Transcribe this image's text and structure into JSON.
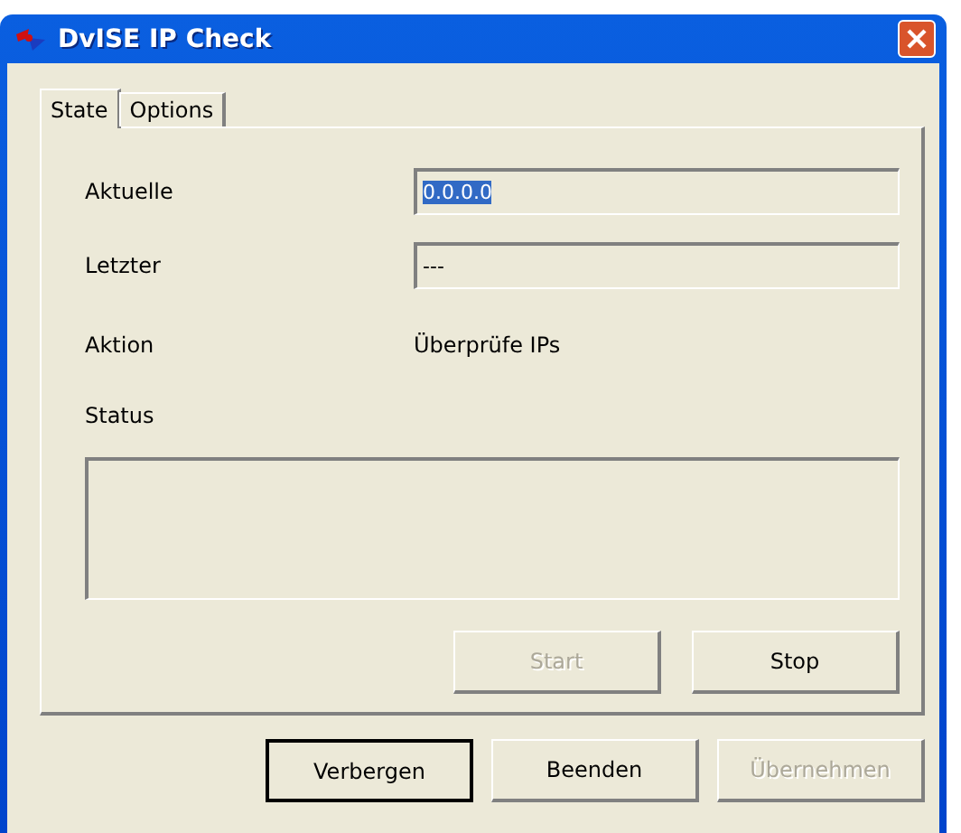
{
  "window": {
    "title": "DvISE IP Check"
  },
  "tabs": [
    {
      "label": "State",
      "selected": true
    },
    {
      "label": "Options",
      "selected": false
    }
  ],
  "fields": [
    {
      "label": "Aktuelle",
      "value": "0.0.0.0",
      "selected": true
    },
    {
      "label": "Letzter",
      "value": "---",
      "selected": false
    }
  ],
  "action": {
    "label": "Aktion",
    "value": "Überprüfe IPs"
  },
  "status": {
    "label": "Status"
  },
  "panel_buttons": [
    {
      "label": "Start",
      "disabled": true,
      "default": false
    },
    {
      "label": "Stop",
      "disabled": false,
      "default": false
    }
  ],
  "dialog_buttons": [
    {
      "label": "Verbergen",
      "disabled": false,
      "default": true
    },
    {
      "label": "Beenden",
      "disabled": false,
      "default": false
    },
    {
      "label": "Übernehmen",
      "disabled": true,
      "default": false
    }
  ]
}
